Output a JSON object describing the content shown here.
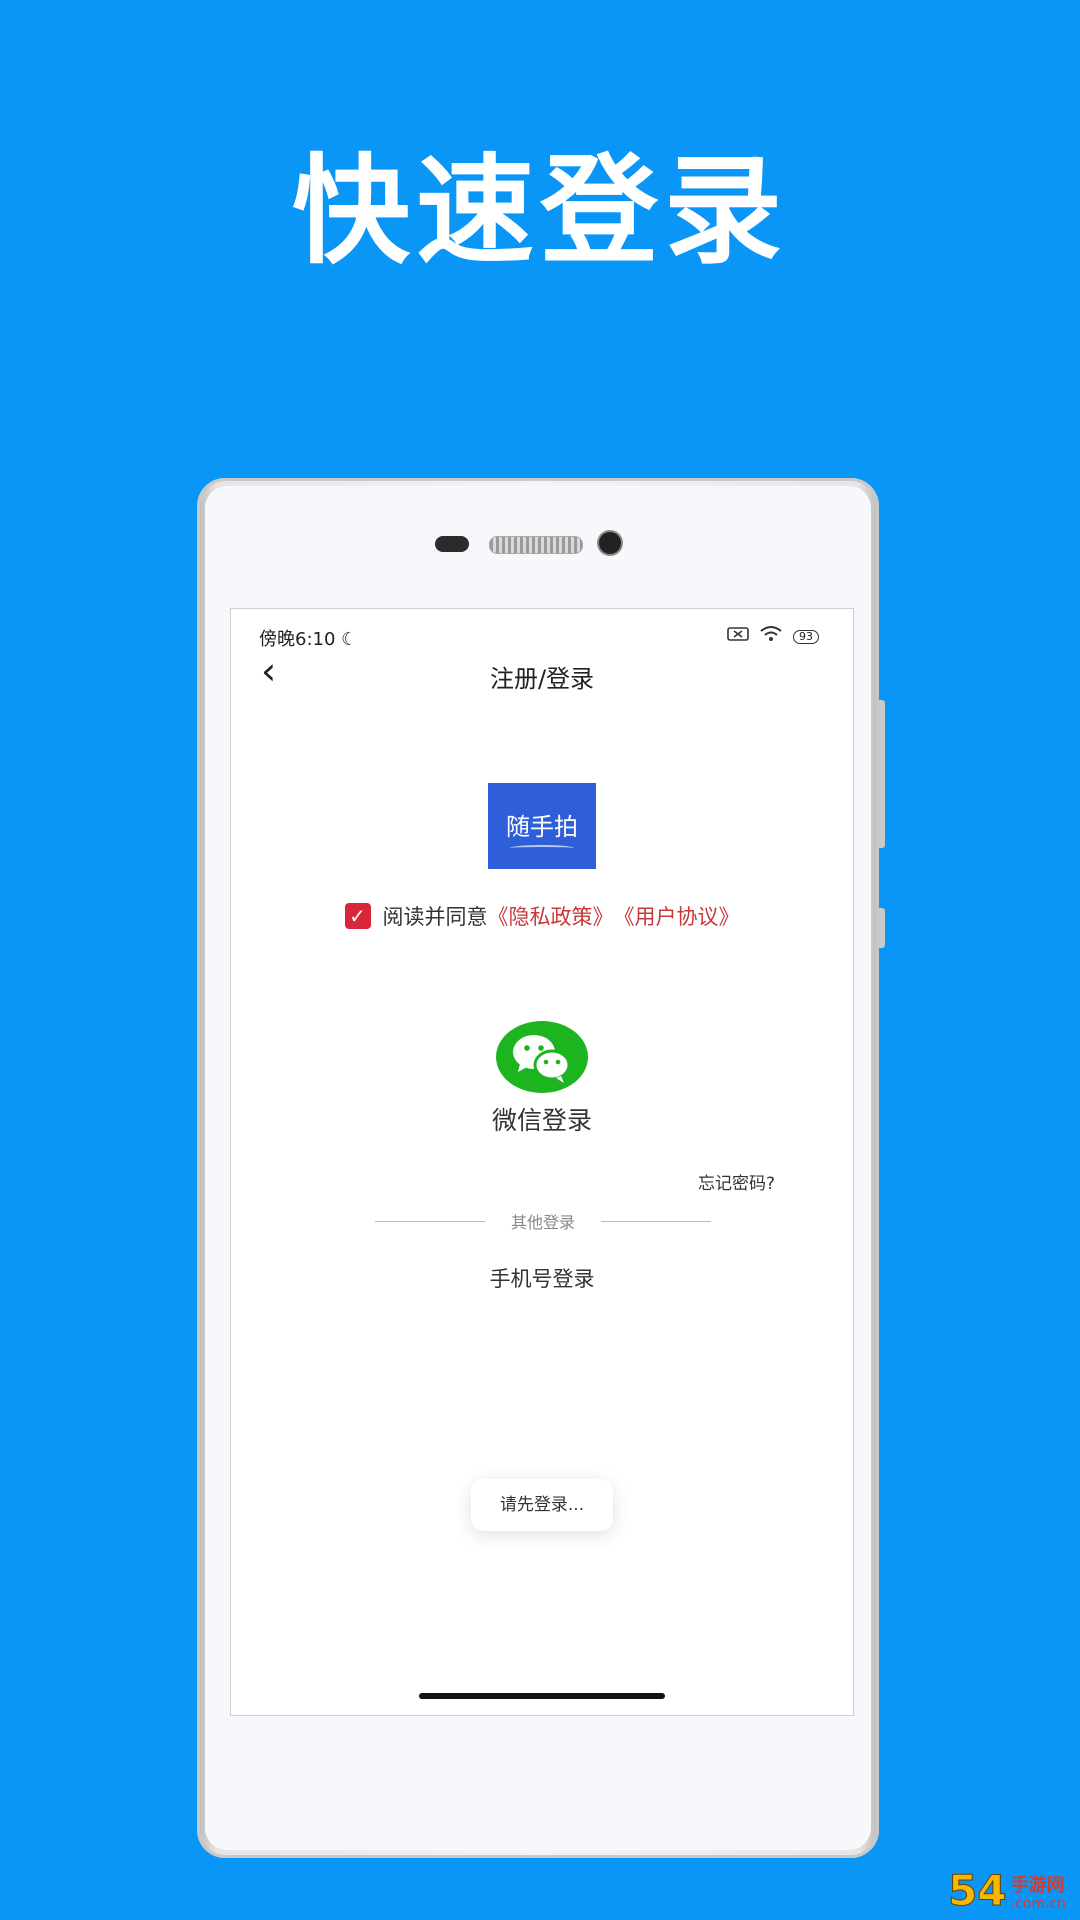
{
  "headline": "快速登录",
  "status_bar": {
    "time": "傍晚6:10",
    "battery": "93"
  },
  "nav": {
    "title": "注册/登录"
  },
  "logo": {
    "text": "随手拍"
  },
  "agreement": {
    "prefix": "阅读并同意",
    "privacy_link": "《隐私政策》",
    "terms_link": "《用户协议》",
    "checked": true
  },
  "wechat": {
    "label": "微信登录"
  },
  "forgot_password": "忘记密码?",
  "other_login_label": "其他登录",
  "phone_login": "手机号登录",
  "toast": "请先登录...",
  "watermark": {
    "number": "54",
    "site": "手游网",
    "url": ".com.cn"
  },
  "colors": {
    "background": "#0a96f7",
    "logo_bg": "#2f5fd8",
    "wechat_green": "#1db51f",
    "link_red": "#c8383a",
    "checkbox_red": "#d9263a"
  }
}
